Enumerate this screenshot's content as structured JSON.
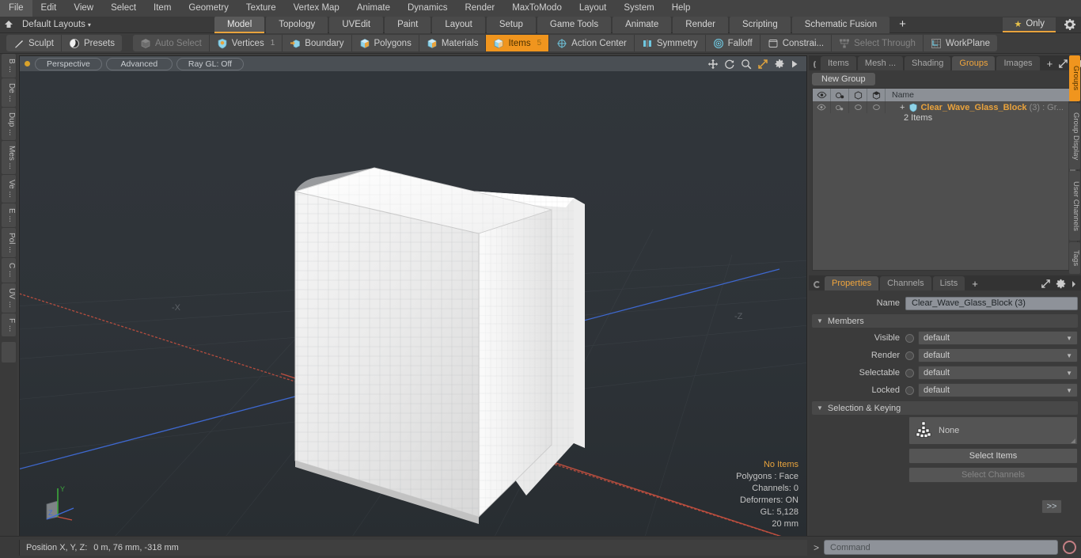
{
  "app": {
    "title": "Modo",
    "accent": "#f0951e",
    "orange_text": "#e9a23c",
    "viewport_bg": "#2c3136"
  },
  "menubar": {
    "items": [
      {
        "label": "File"
      },
      {
        "label": "Edit"
      },
      {
        "label": "View"
      },
      {
        "label": "Select"
      },
      {
        "label": "Item"
      },
      {
        "label": "Geometry"
      },
      {
        "label": "Texture"
      },
      {
        "label": "Vertex Map"
      },
      {
        "label": "Animate"
      },
      {
        "label": "Dynamics"
      },
      {
        "label": "Render"
      },
      {
        "label": "MaxToModo"
      },
      {
        "label": "Layout"
      },
      {
        "label": "System"
      },
      {
        "label": "Help"
      }
    ]
  },
  "layoutbar": {
    "home_icon": "home-icon",
    "layouts_label": "Default Layouts",
    "caret": "▾",
    "tabs": [
      {
        "label": "Model",
        "active": true
      },
      {
        "label": "Topology",
        "active": false
      },
      {
        "label": "UVEdit",
        "active": false
      },
      {
        "label": "Paint",
        "active": false
      },
      {
        "label": "Layout",
        "active": false
      },
      {
        "label": "Setup",
        "active": false
      },
      {
        "label": "Game Tools",
        "active": false
      },
      {
        "label": "Animate",
        "active": false
      },
      {
        "label": "Render",
        "active": false
      },
      {
        "label": "Scripting",
        "active": false
      },
      {
        "label": "Schematic Fusion",
        "active": false
      }
    ],
    "add_label": "+",
    "only_label": "Only",
    "star_glyph": "★",
    "gear_icon": "gear-icon"
  },
  "toolbar": {
    "group1": [
      {
        "label": "Sculpt",
        "icon": "pen-icon",
        "state": "normal"
      },
      {
        "label": "Presets",
        "icon": "sphere-icon",
        "state": "normal"
      }
    ],
    "group2": [
      {
        "label": "Auto Select",
        "icon": "cube-gray-icon",
        "state": "dim",
        "num": ""
      },
      {
        "label": "Vertices",
        "icon": "shield-icon",
        "state": "normal",
        "num": "1"
      },
      {
        "label": "Boundary",
        "icon": "arrow-cube-icon",
        "state": "normal",
        "num": ""
      },
      {
        "label": "Polygons",
        "icon": "cube-icon",
        "state": "normal",
        "num": ""
      },
      {
        "label": "Materials",
        "icon": "cube-icon",
        "state": "normal",
        "num": ""
      },
      {
        "label": "Items",
        "icon": "cube-icon",
        "state": "active",
        "num": "5"
      },
      {
        "label": "Action Center",
        "icon": "target-icon",
        "state": "normal",
        "num": ""
      },
      {
        "label": "Symmetry",
        "icon": "symmetry-icon",
        "state": "normal",
        "num": ""
      },
      {
        "label": "Falloff",
        "icon": "falloff-icon",
        "state": "normal",
        "num": ""
      },
      {
        "label": "Constrai...",
        "icon": "square-icon",
        "state": "normal",
        "num": ""
      },
      {
        "label": "Select Through",
        "icon": "network-icon",
        "state": "dim",
        "num": ""
      },
      {
        "label": "WorkPlane",
        "icon": "workplane-icon",
        "state": "normal",
        "num": ""
      }
    ]
  },
  "left_rail": {
    "tabs": [
      "B ...",
      "De ...",
      "Dup ...",
      "Mes ...",
      "Ve ...",
      "E ...",
      "Pol ...",
      "C ...",
      "UV ...",
      "F ..."
    ]
  },
  "viewport": {
    "dot_color": "#d9a22a",
    "pills": [
      {
        "label": "Perspective"
      },
      {
        "label": "Advanced"
      },
      {
        "label": "Ray GL: Off"
      }
    ],
    "icons": [
      "move-icon",
      "rotate-icon",
      "zoom-icon",
      "fit-icon",
      "settings-icon",
      "play-icon"
    ],
    "axis_labels": {
      "neg_x": "-X",
      "neg_z": "-Z",
      "gizmo_y": "Y",
      "gizmo_z": "Z"
    },
    "stats": {
      "selection": "No Items",
      "polygons": "Polygons : Face",
      "channels": "Channels: 0",
      "deformers": "Deformers: ON",
      "gl": "GL: 5,128",
      "unit": "20 mm"
    }
  },
  "right_panel": {
    "top_tabs": [
      {
        "label": "Items",
        "active": false
      },
      {
        "label": "Mesh ...",
        "active": false
      },
      {
        "label": "Shading",
        "active": false
      },
      {
        "label": "Groups",
        "active": true
      },
      {
        "label": "Images",
        "active": false
      }
    ],
    "top_add": "+",
    "new_group_label": "New Group",
    "list": {
      "columns": [
        "eye-icon",
        "render-icon",
        "wire-icon",
        "shade-icon",
        "Name"
      ],
      "name_header": "Name",
      "rows": [
        {
          "expander": "+",
          "name": "Clear_Wave_Glass_Block",
          "count": "(3) : Gr...",
          "subtitle": "2 Items"
        }
      ]
    },
    "properties": {
      "tabs": [
        {
          "label": "Properties",
          "active": true
        },
        {
          "label": "Channels",
          "active": false
        },
        {
          "label": "Lists",
          "active": false
        }
      ],
      "add": "+",
      "name_label": "Name",
      "name_value": "Clear_Wave_Glass_Block (3)",
      "members_section": "Members",
      "fields": [
        {
          "label": "Visible",
          "value": "default"
        },
        {
          "label": "Render",
          "value": "default"
        },
        {
          "label": "Selectable",
          "value": "default"
        },
        {
          "label": "Locked",
          "value": "default"
        }
      ],
      "selection_section": "Selection & Keying",
      "selection_value": "None",
      "select_items_label": "Select Items",
      "select_channels_label": "Select Channels",
      "expand_label": ">>"
    },
    "right_rail": [
      {
        "label": "Groups",
        "active": true
      },
      {
        "label": "Group Display",
        "active": false
      },
      {
        "label": "User Channels",
        "active": false
      },
      {
        "label": "Tags",
        "active": false
      }
    ]
  },
  "statusbar": {
    "position_label": "Position X, Y, Z:",
    "position_value": "0 m, 76 mm, -318 mm",
    "command_prompt": ">",
    "command_placeholder": "Command",
    "record_icon": "record-icon"
  }
}
